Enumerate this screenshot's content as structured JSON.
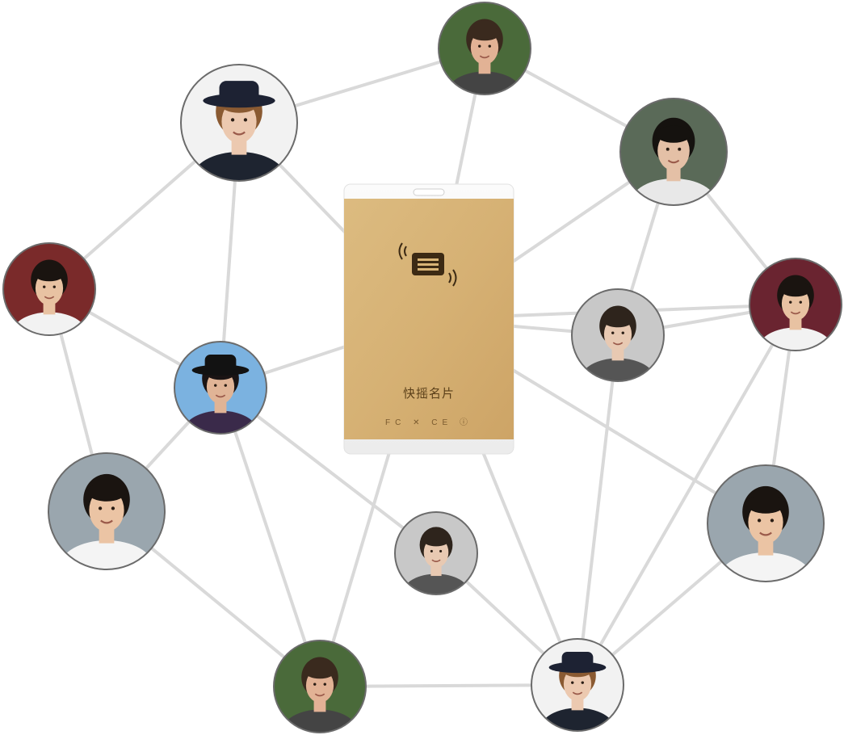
{
  "colors": {
    "background": "#ffffff",
    "edge": "#d9d9d9",
    "node_ring": "#6b6b6b",
    "card_gold": "#d8b476",
    "card_gold_dark": "#c9a060",
    "card_white": "#f6f6f6",
    "card_chip": "#3c2a14"
  },
  "device": {
    "brand": "快摇名片",
    "fine_print": [],
    "certifications": "FC ✕ CE ⓘ",
    "icon": "nfc-card-icon"
  },
  "nodes": [
    {
      "id": "n1",
      "person": "man-smiling-top"
    },
    {
      "id": "n2",
      "person": "man-hat-left"
    },
    {
      "id": "n3",
      "person": "man-glasses"
    },
    {
      "id": "n4",
      "person": "man-left"
    },
    {
      "id": "n5",
      "person": "man-right"
    },
    {
      "id": "n6",
      "person": "man-looking-down-mid"
    },
    {
      "id": "n7",
      "person": "woman-hat-sunglasses"
    },
    {
      "id": "n8",
      "person": "woman-smiling-left"
    },
    {
      "id": "n9",
      "person": "woman-smiling-right"
    },
    {
      "id": "n10",
      "person": "man-looking-down-low"
    },
    {
      "id": "n11",
      "person": "man-smiling-bottom"
    },
    {
      "id": "n12",
      "person": "man-hat-bottom"
    }
  ],
  "edges": [
    [
      "n2",
      "n1"
    ],
    [
      "n1",
      "n3"
    ],
    [
      "n2",
      "card"
    ],
    [
      "n1",
      "card"
    ],
    [
      "n3",
      "card"
    ],
    [
      "n2",
      "n4"
    ],
    [
      "n2",
      "n7"
    ],
    [
      "n3",
      "n5"
    ],
    [
      "n3",
      "n6"
    ],
    [
      "n4",
      "n7"
    ],
    [
      "n4",
      "n8"
    ],
    [
      "n7",
      "card"
    ],
    [
      "n7",
      "n8"
    ],
    [
      "n7",
      "n10"
    ],
    [
      "n7",
      "n11"
    ],
    [
      "n5",
      "card"
    ],
    [
      "n5",
      "n6"
    ],
    [
      "n5",
      "n9"
    ],
    [
      "n5",
      "n12"
    ],
    [
      "n6",
      "card"
    ],
    [
      "n6",
      "n12"
    ],
    [
      "card",
      "n9"
    ],
    [
      "card",
      "n11"
    ],
    [
      "card",
      "n12"
    ],
    [
      "n8",
      "n11"
    ],
    [
      "n10",
      "n12"
    ],
    [
      "n11",
      "n12"
    ],
    [
      "n9",
      "n12"
    ]
  ]
}
